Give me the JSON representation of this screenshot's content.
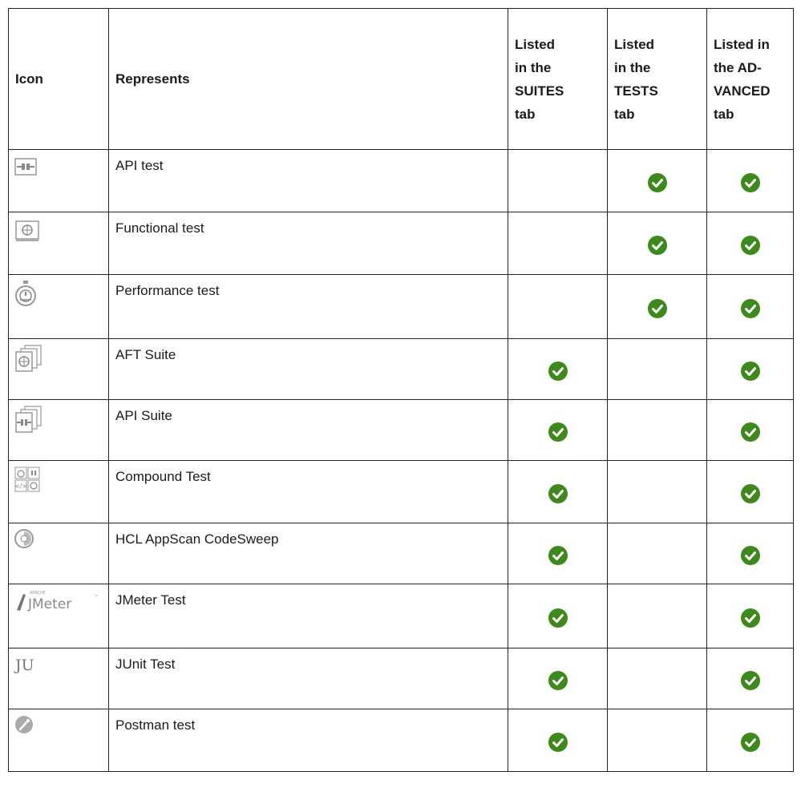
{
  "table": {
    "headers": {
      "icon": "Icon",
      "represents": "Represents",
      "suites_lines": [
        "Listed",
        "in the",
        "SUITES",
        "tab"
      ],
      "tests_lines": [
        "Listed",
        "in the",
        "TESTS",
        "tab"
      ],
      "advanced_lines": [
        "Listed in",
        "the AD-",
        "VANCED",
        "tab"
      ]
    },
    "rows": [
      {
        "icon": "api-test-icon",
        "represents": "API test",
        "suites": false,
        "tests": true,
        "advanced": true
      },
      {
        "icon": "functional-test-icon",
        "represents": "Functional test",
        "suites": false,
        "tests": true,
        "advanced": true
      },
      {
        "icon": "performance-test-icon",
        "represents": "Performance test",
        "suites": false,
        "tests": true,
        "advanced": true
      },
      {
        "icon": "aft-suite-icon",
        "represents": "AFT Suite",
        "suites": true,
        "tests": false,
        "advanced": true
      },
      {
        "icon": "api-suite-icon",
        "represents": "API Suite",
        "suites": true,
        "tests": false,
        "advanced": true
      },
      {
        "icon": "compound-test-icon",
        "represents": "Compound Test",
        "suites": true,
        "tests": false,
        "advanced": true
      },
      {
        "icon": "codesweep-icon",
        "represents": "HCL AppScan CodeSweep",
        "suites": true,
        "tests": false,
        "advanced": true
      },
      {
        "icon": "jmeter-icon",
        "represents": "JMeter Test",
        "suites": true,
        "tests": false,
        "advanced": true,
        "icon_text": "JMeter",
        "icon_small_text": "APACHE"
      },
      {
        "icon": "junit-icon",
        "represents": "JUnit Test",
        "suites": true,
        "tests": false,
        "advanced": true,
        "icon_text": "JU"
      },
      {
        "icon": "postman-icon",
        "represents": "Postman test",
        "suites": true,
        "tests": false,
        "advanced": true
      }
    ]
  },
  "colors": {
    "check": "#3c8a1c",
    "border": "#222222",
    "icon_gray": "#9a9a9a"
  }
}
